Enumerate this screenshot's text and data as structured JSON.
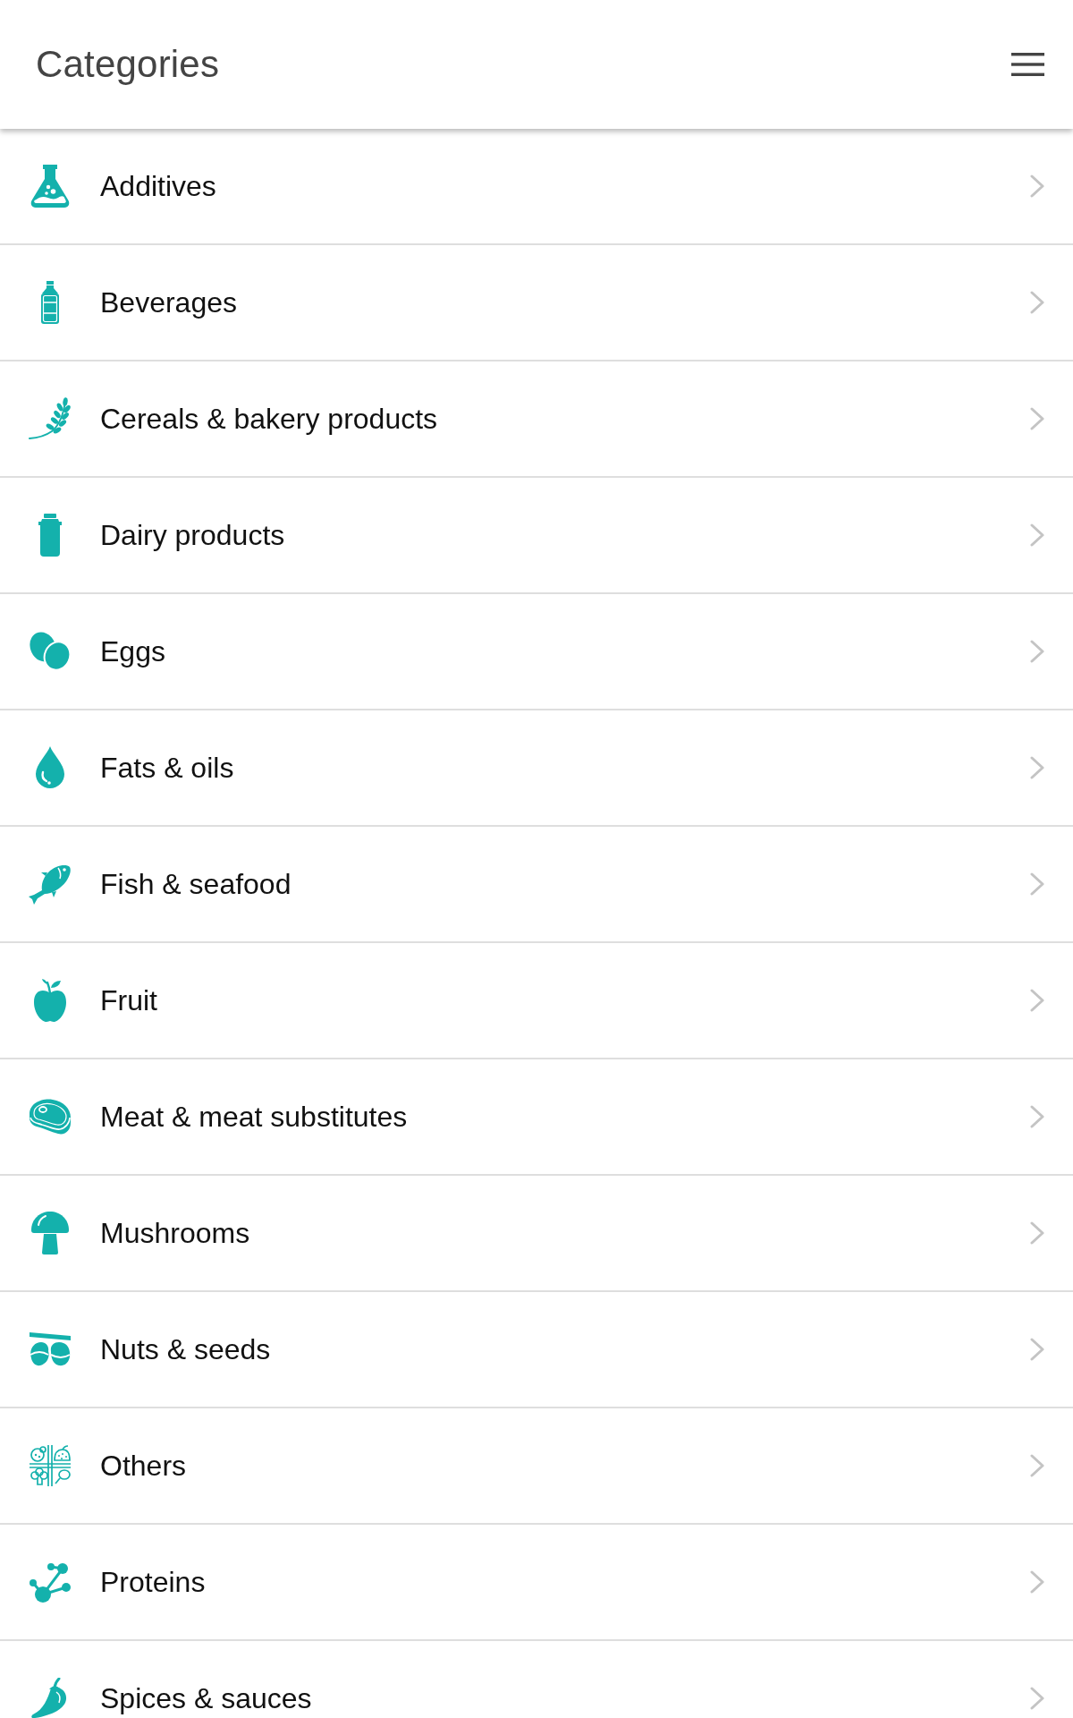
{
  "header": {
    "title": "Categories"
  },
  "categories": [
    {
      "label": "Additives",
      "kind": "flask"
    },
    {
      "label": "Beverages",
      "kind": "bottle"
    },
    {
      "label": "Cereals & bakery products",
      "kind": "wheat"
    },
    {
      "label": "Dairy products",
      "kind": "milkcan"
    },
    {
      "label": "Eggs",
      "kind": "eggs"
    },
    {
      "label": "Fats & oils",
      "kind": "drop"
    },
    {
      "label": "Fish & seafood",
      "kind": "fish"
    },
    {
      "label": "Fruit",
      "kind": "apple"
    },
    {
      "label": "Meat & meat substitutes",
      "kind": "steak"
    },
    {
      "label": "Mushrooms",
      "kind": "mushroom"
    },
    {
      "label": "Nuts & seeds",
      "kind": "nuts"
    },
    {
      "label": "Others",
      "kind": "foodgrid"
    },
    {
      "label": "Proteins",
      "kind": "molecule"
    },
    {
      "label": "Spices & sauces",
      "kind": "chili"
    }
  ]
}
